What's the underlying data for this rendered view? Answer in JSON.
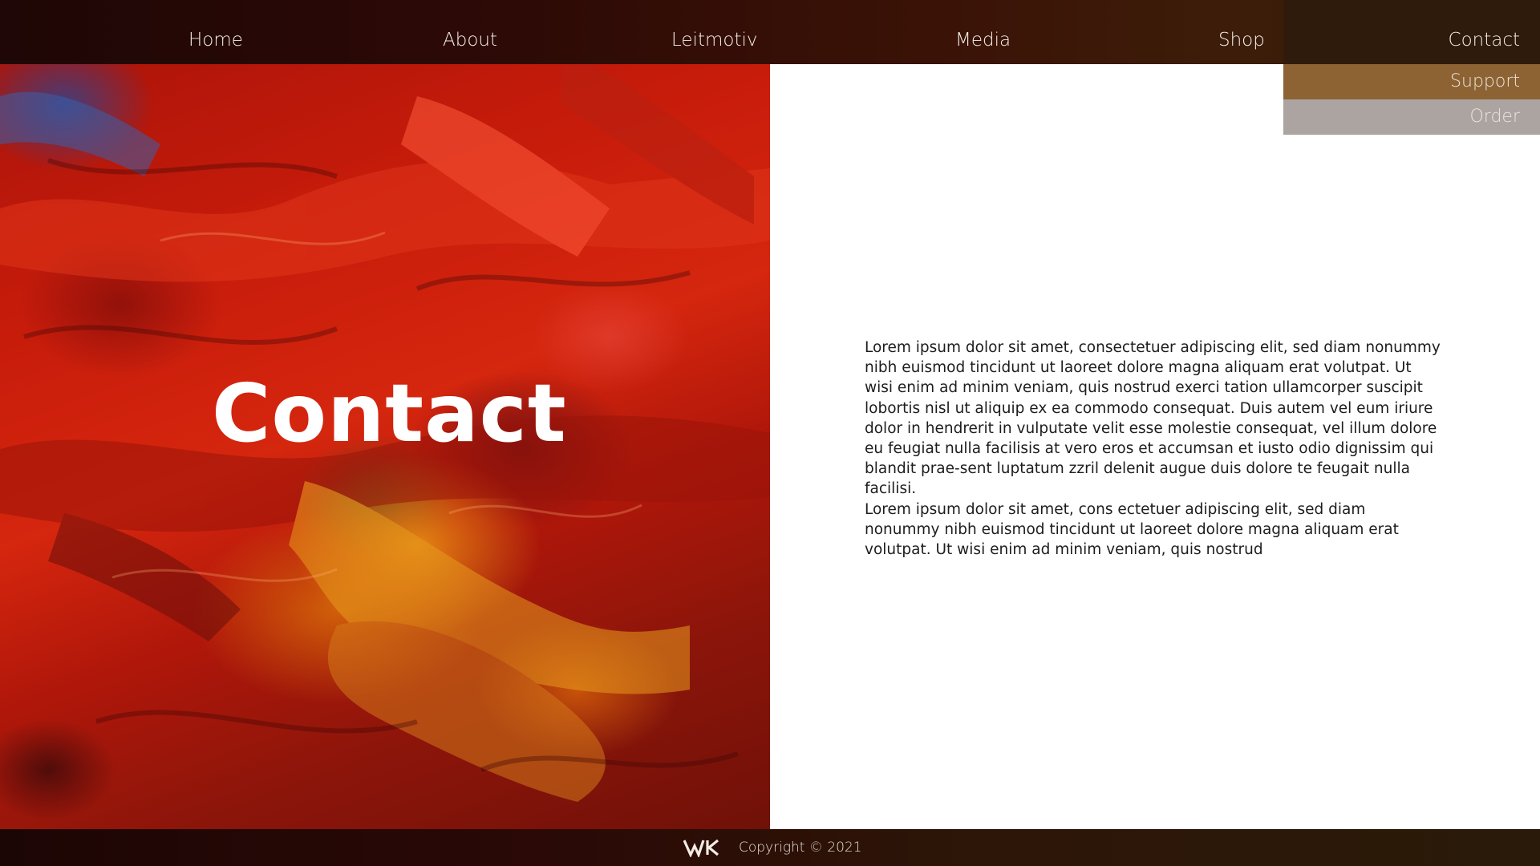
{
  "nav": {
    "items": [
      {
        "label": "Home"
      },
      {
        "label": "About"
      },
      {
        "label": "Leitmotiv"
      },
      {
        "label": "Media"
      },
      {
        "label": "Shop"
      },
      {
        "label": "Contact"
      }
    ],
    "dropdown": [
      {
        "label": "Support"
      },
      {
        "label": "Order"
      }
    ]
  },
  "hero": {
    "title": "Contact"
  },
  "content": {
    "paragraphs": [
      "Lorem ipsum dolor sit amet, consectetuer adipiscing elit, sed diam nonummy nibh euismod tincidunt ut laoreet dolore magna aliquam erat volutpat. Ut wisi enim ad minim veniam, quis nostrud exerci tation ullamcorper suscipit lobortis nisl ut aliquip ex ea commodo consequat. Duis autem vel eum iriure dolor in hendrerit in vulputate velit esse molestie consequat, vel illum dolore eu feugiat nulla facilisis at vero eros et accumsan et iusto odio dignissim qui blandit prae-sent luptatum zzril delenit augue duis dolore te feugait nulla facilisi.",
      "Lorem ipsum dolor sit amet, cons ectetuer adipiscing elit, sed diam nonummy nibh euismod tincidunt ut laoreet dolore magna aliquam erat volutpat. Ut wisi enim ad minim veniam, quis nostrud"
    ]
  },
  "footer": {
    "logo": "WK",
    "copyright": "Copyright © 2021"
  },
  "colors": {
    "nav_text": "#f4efe8",
    "dropdown_support_bg": "#8d6334",
    "dropdown_order_bg": "#aca4a1",
    "body_text": "#1d1d1d",
    "hero_accent": "#c81c0b"
  },
  "icons": {
    "footer_logo": "wk-logo-icon"
  }
}
